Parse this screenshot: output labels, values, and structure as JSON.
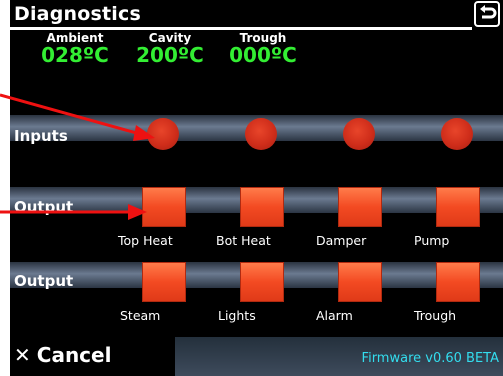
{
  "header": {
    "title": "Diagnostics",
    "back_icon": "return-arrow-icon"
  },
  "temps": [
    {
      "label": "Ambient",
      "value": "028ºC"
    },
    {
      "label": "Cavity",
      "value": "200ºC"
    },
    {
      "label": "Trough",
      "value": "000ºC"
    }
  ],
  "inputs": {
    "label": "Inputs",
    "count": 4,
    "state_color": "#d3301c"
  },
  "output1": {
    "label": "Output",
    "items": [
      "Top Heat",
      "Bot Heat",
      "Damper",
      "Pump"
    ]
  },
  "output2": {
    "label": "Output",
    "items": [
      "Steam",
      "Lights",
      "Alarm",
      "Trough"
    ]
  },
  "footer": {
    "cancel_label": "Cancel",
    "firmware": "Firmware v0.60 BETA"
  },
  "colors": {
    "accent_green": "#33ee33",
    "accent_cyan": "#33ddee",
    "annotation_red": "#ee1111"
  }
}
